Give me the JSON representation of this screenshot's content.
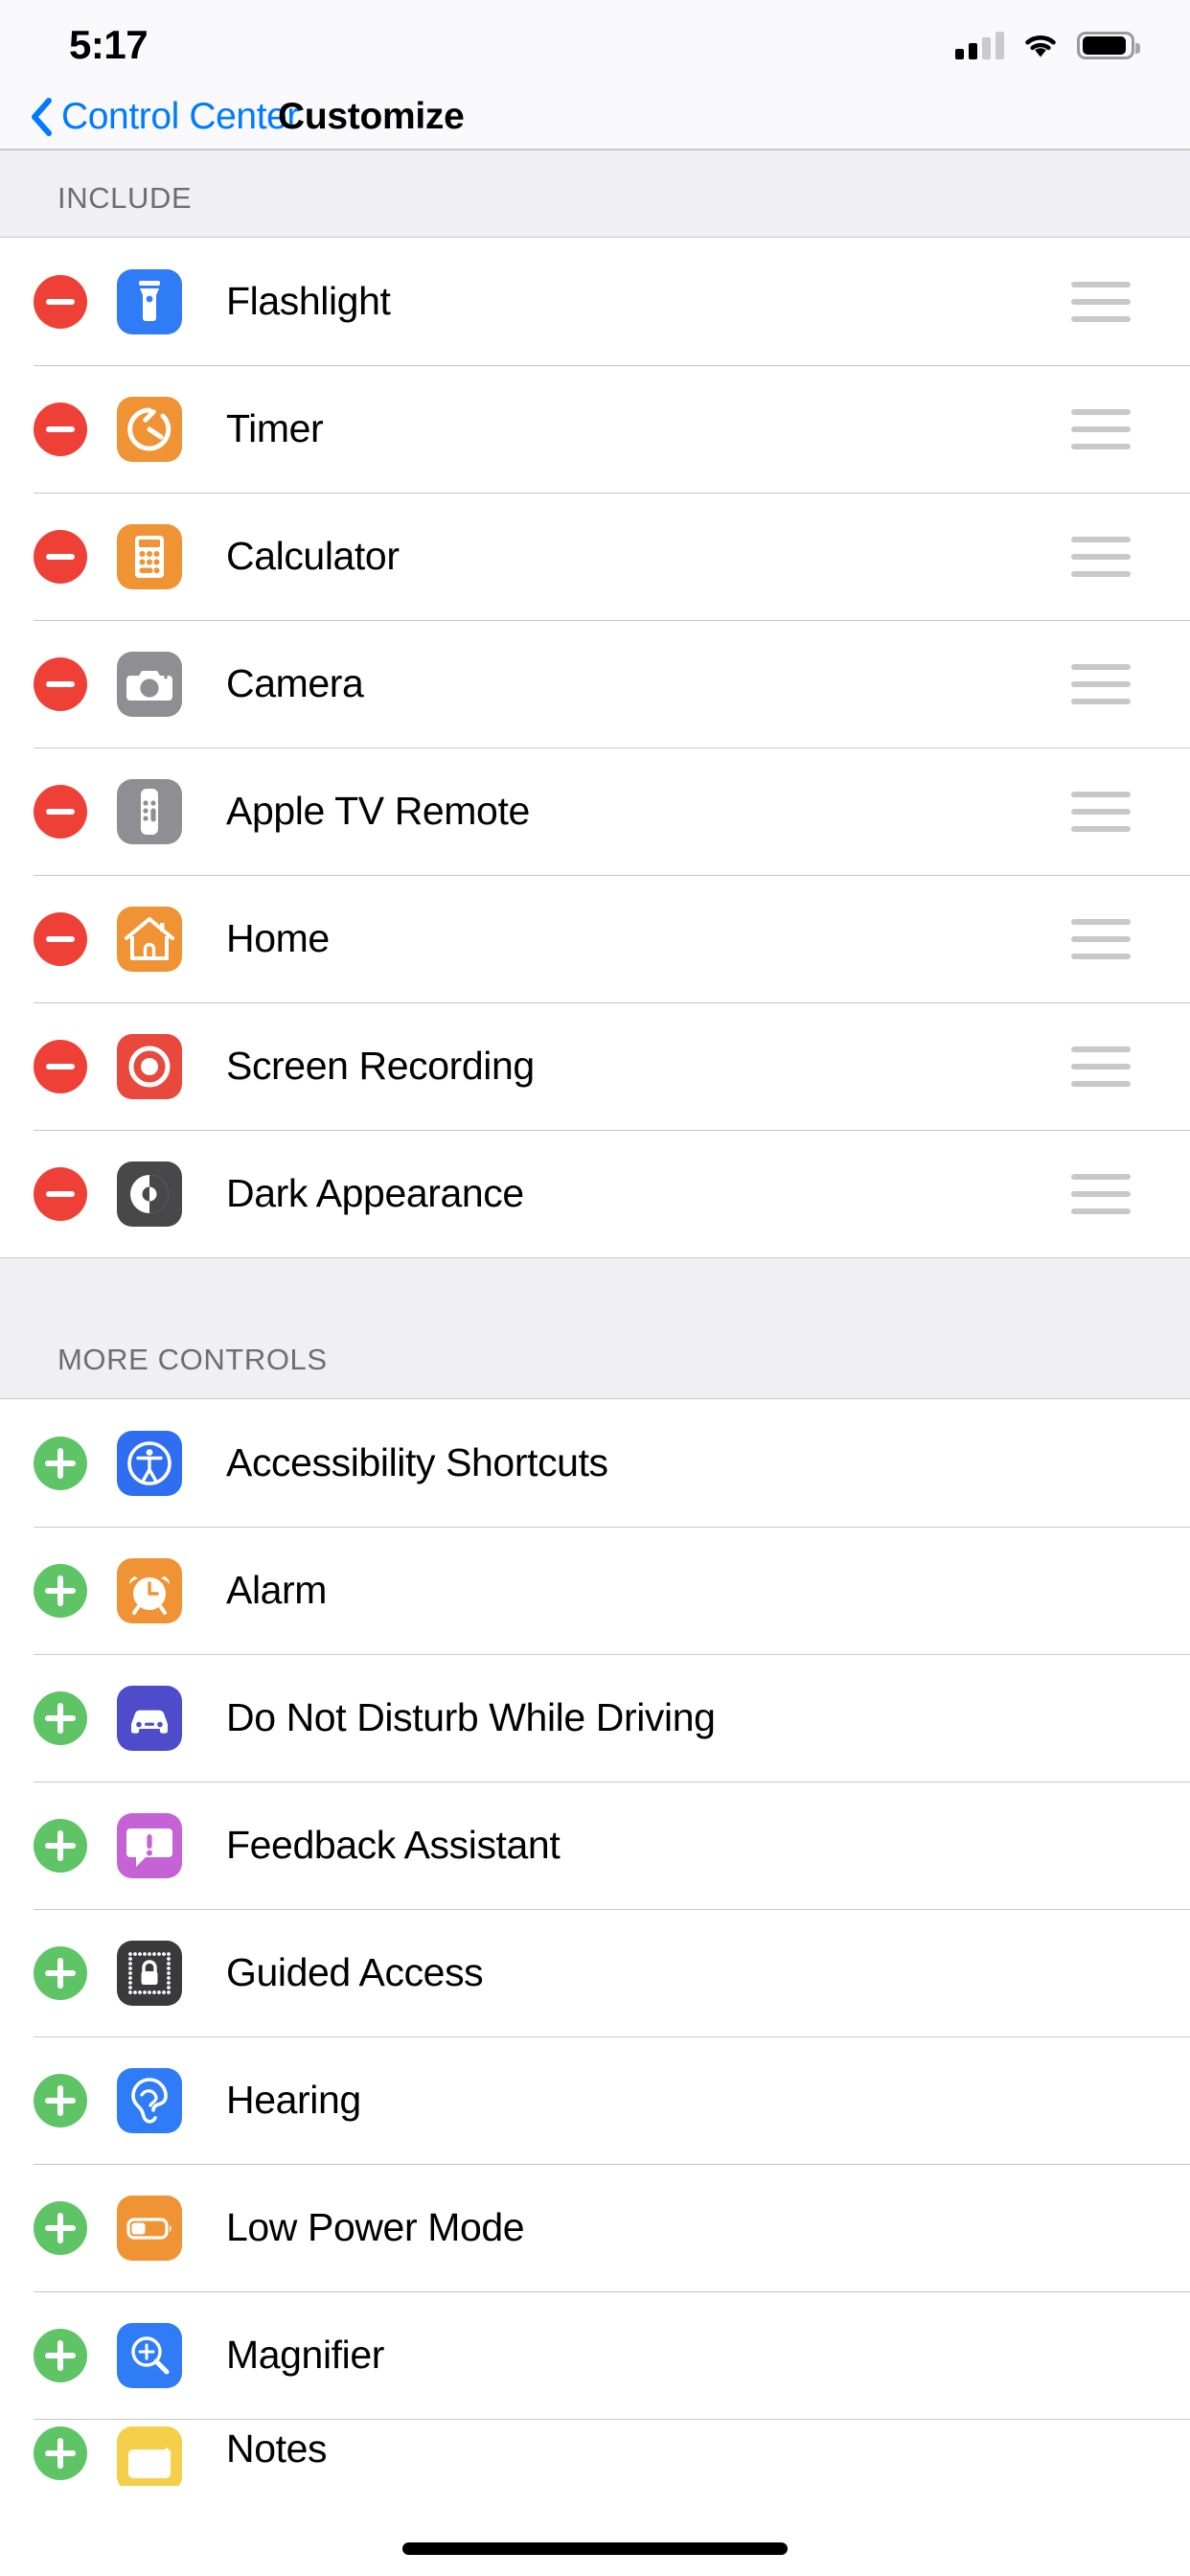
{
  "status_bar": {
    "time": "5:17",
    "signal_icon": "cellular-signal-icon",
    "signal_bars_filled": 2,
    "signal_bars_total": 4,
    "wifi_icon": "wifi-icon",
    "battery_icon": "battery-icon",
    "battery_level_percent": 78
  },
  "nav": {
    "back_label": "Control Center",
    "back_icon": "chevron-left-icon",
    "title": "Customize"
  },
  "colors": {
    "accent_blue": "#007aff",
    "remove_red": "#ee4036",
    "add_green": "#5fc466",
    "section_bg": "#efeff4",
    "separator": "#c8c7cc",
    "handle_gray": "#c7c7cc"
  },
  "sections": [
    {
      "header": "INCLUDE",
      "action": "remove",
      "action_icon": "minus-circle-icon",
      "has_drag_handles": true,
      "items": [
        {
          "label": "Flashlight",
          "icon": "flashlight-icon",
          "icon_bg": "#2f7cf6"
        },
        {
          "label": "Timer",
          "icon": "timer-icon",
          "icon_bg": "#ef9334"
        },
        {
          "label": "Calculator",
          "icon": "calculator-icon",
          "icon_bg": "#ef9334"
        },
        {
          "label": "Camera",
          "icon": "camera-icon",
          "icon_bg": "#8e8e93"
        },
        {
          "label": "Apple TV Remote",
          "icon": "tv-remote-icon",
          "icon_bg": "#8e8e93"
        },
        {
          "label": "Home",
          "icon": "home-icon",
          "icon_bg": "#ef9334"
        },
        {
          "label": "Screen Recording",
          "icon": "screen-recording-icon",
          "icon_bg": "#e9483c"
        },
        {
          "label": "Dark Appearance",
          "icon": "dark-appearance-icon",
          "icon_bg": "#48484a"
        }
      ]
    },
    {
      "header": "MORE CONTROLS",
      "action": "add",
      "action_icon": "plus-circle-icon",
      "has_drag_handles": false,
      "items": [
        {
          "label": "Accessibility Shortcuts",
          "icon": "accessibility-icon",
          "icon_bg": "#2f6ef0"
        },
        {
          "label": "Alarm",
          "icon": "alarm-clock-icon",
          "icon_bg": "#ef9334"
        },
        {
          "label": "Do Not Disturb While Driving",
          "icon": "car-icon",
          "icon_bg": "#4e4ccb"
        },
        {
          "label": "Feedback Assistant",
          "icon": "feedback-icon",
          "icon_bg": "#c462d6"
        },
        {
          "label": "Guided Access",
          "icon": "guided-access-icon",
          "icon_bg": "#3a3a3c"
        },
        {
          "label": "Hearing",
          "icon": "hearing-ear-icon",
          "icon_bg": "#2f7cf6"
        },
        {
          "label": "Low Power Mode",
          "icon": "low-power-battery-icon",
          "icon_bg": "#ef9334"
        },
        {
          "label": "Magnifier",
          "icon": "magnifier-icon",
          "icon_bg": "#2f7cf6"
        },
        {
          "label": "Notes",
          "icon": "notes-icon",
          "icon_bg": "#f5ce4a"
        }
      ]
    }
  ],
  "home_indicator": "home-indicator"
}
